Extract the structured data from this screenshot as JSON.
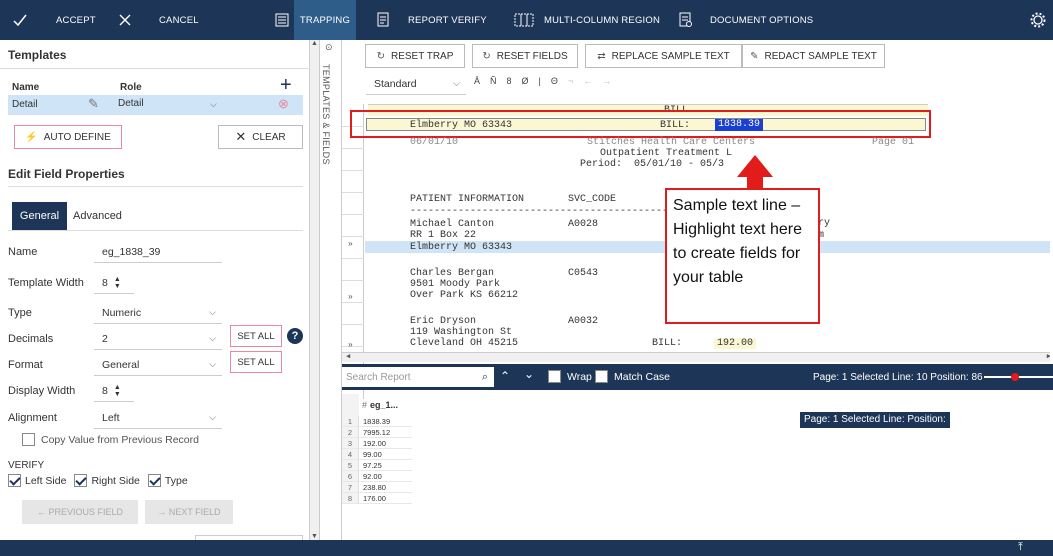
{
  "toolbar": {
    "accept": "ACCEPT",
    "cancel": "CANCEL",
    "trapping": "TRAPPING",
    "report_verify": "REPORT VERIFY",
    "multi_column": "MULTI-COLUMN REGION",
    "document_options": "DOCUMENT OPTIONS"
  },
  "templates": {
    "title": "Templates",
    "col_name": "Name",
    "col_role": "Role",
    "row_name": "Detail",
    "row_role": "Detail",
    "auto_define": "AUTO DEFINE",
    "clear": "CLEAR"
  },
  "edit": {
    "title": "Edit Field Properties",
    "tab_general": "General",
    "tab_advanced": "Advanced",
    "name_label": "Name",
    "name_value": "eg_1838_39",
    "template_width_label": "Template Width",
    "template_width_value": "8",
    "type_label": "Type",
    "type_value": "Numeric",
    "decimals_label": "Decimals",
    "decimals_value": "2",
    "set_all": "SET ALL",
    "format_label": "Format",
    "format_value": "General",
    "display_width_label": "Display Width",
    "display_width_value": "8",
    "alignment_label": "Alignment",
    "alignment_value": "Left",
    "copy_value": "Copy Value from Previous Record",
    "verify_label": "VERIFY",
    "left_side": "Left Side",
    "right_side": "Right Side",
    "type_check": "Type",
    "prev_field": "← PREVIOUS FIELD",
    "next_field": "→ NEXT FIELD"
  },
  "side_tab": "TEMPLATES & FIELDS",
  "actions": {
    "reset_trap": "RESET TRAP",
    "reset_fields": "RESET FIELDS",
    "replace_sample": "REPLACE SAMPLE TEXT",
    "redact_sample": "REDACT SAMPLE TEXT"
  },
  "format_bar": {
    "style_value": "Standard",
    "chars": [
      "Ā",
      "Ñ",
      "8",
      "Ø",
      "|",
      "Θ",
      "¬",
      "←",
      "→"
    ]
  },
  "report": {
    "header_bill": "BILL",
    "sample_left": "Elmberry MO 63343",
    "sample_bill_label": "BILL:",
    "sample_bill_value": "1838.39",
    "line_date": "06/01/10",
    "line_company": "Stitches Health Care Centers",
    "line_page": "Page 01",
    "line_outpatient": "Outpatient Treatment L",
    "line_period": "Period:  05/01/10 - 05/3",
    "col_patient": "PATIENT INFORMATION",
    "col_svc": "SVC_CODE",
    "col_tail": "ry",
    "divider": "-----------------------------------------------------------------",
    "p1_name": "Michael Canton",
    "p1_code": "A0028",
    "p1_addr": "RR 1 Box 22",
    "p1_tail": "m",
    "p1_city": "Elmberry MO 63343",
    "p2_name": "Charles Bergan",
    "p2_code": "C0543",
    "p2_addr": "9501 Moody Park",
    "p2_city": "Over Park KS 66212",
    "p3_name": "Eric Dryson",
    "p3_code": "A0032",
    "p3_addr": "119 Washington St",
    "p3_city": "Cleveland OH 45215",
    "p3_bill_label": "BILL:",
    "p3_bill_value": "192.00"
  },
  "callout": "Sample text line – Highlight text here to create fields for your table",
  "search": {
    "placeholder": "Search Report",
    "wrap": "Wrap",
    "match_case": "Match Case",
    "status": "Page: 1  Selected Line: 10  Position: 86"
  },
  "grid": {
    "header": "eg_1...",
    "header_hash": "#",
    "rows": [
      {
        "n": "1",
        "v": "1838.39"
      },
      {
        "n": "2",
        "v": "7995.12"
      },
      {
        "n": "3",
        "v": "192.00"
      },
      {
        "n": "4",
        "v": "99.00"
      },
      {
        "n": "5",
        "v": "97.25"
      },
      {
        "n": "6",
        "v": "92.00"
      },
      {
        "n": "7",
        "v": "238.80"
      },
      {
        "n": "8",
        "v": "176.00"
      }
    ]
  },
  "grid_status": "Page: 1  Selected Line:  Position:",
  "colors": {
    "navy": "#1d3557",
    "highlight": "#cfe4f7",
    "accent_red": "#e21b1b",
    "sample_yellow": "#fbf7d3"
  }
}
